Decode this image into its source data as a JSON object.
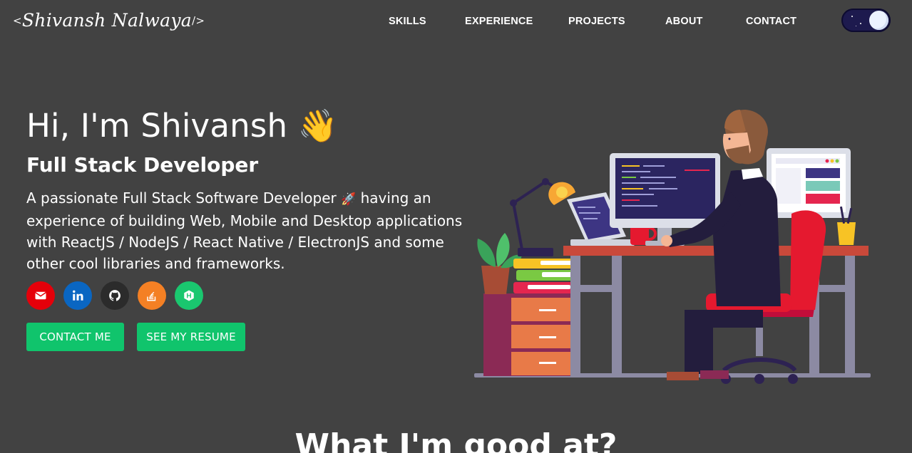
{
  "logo": {
    "open": "<",
    "name": "Shivansh Nalwaya",
    "close": "/>"
  },
  "nav": {
    "items": [
      {
        "label": "SKILLS"
      },
      {
        "label": "EXPERIENCE"
      },
      {
        "label": "PROJECTS"
      },
      {
        "label": "ABOUT"
      },
      {
        "label": "CONTACT"
      }
    ]
  },
  "theme_toggle": {
    "mode": "dark"
  },
  "hero": {
    "greeting": "Hi, I'm Shivansh",
    "wave_emoji": "👋",
    "subtitle": "Full Stack Developer",
    "description_before": "A passionate Full Stack Software Developer ",
    "rocket_emoji": "🚀",
    "description_after": " having an experience of building Web, Mobile and Desktop applications with ReactJS / NodeJS / React Native / ElectronJS and some other cool libraries and frameworks."
  },
  "social_links": [
    {
      "icon": "envelope-icon",
      "color": "#e5000a"
    },
    {
      "icon": "linkedin-icon",
      "color": "#0a66c2"
    },
    {
      "icon": "github-icon",
      "color": "#333333"
    },
    {
      "icon": "stack-overflow-icon",
      "color": "#f48024"
    },
    {
      "icon": "hackerrank-icon",
      "color": "#1ac76f"
    }
  ],
  "buttons": {
    "contact_label": "CONTACT ME",
    "resume_label": "SEE MY RESUME",
    "accent": "#10c46c"
  },
  "skills_section": {
    "title": "What I'm good at?"
  },
  "colors": {
    "background": "#424242",
    "toggle_bg": "#1d1a4e"
  }
}
